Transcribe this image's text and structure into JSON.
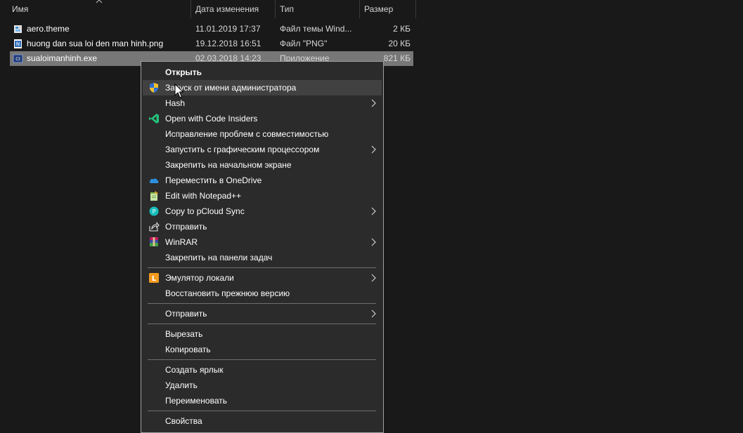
{
  "columns": {
    "name": "Имя",
    "date": "Дата изменения",
    "type": "Тип",
    "size": "Размер"
  },
  "files": [
    {
      "name": "aero.theme",
      "date": "11.01.2019 17:37",
      "type": "Файл темы Wind...",
      "size": "2 КБ",
      "icon": "theme-file-icon"
    },
    {
      "name": "huong dan sua loi den man hinh.png",
      "date": "19.12.2018 16:51",
      "type": "Файл \"PNG\"",
      "size": "20 КБ",
      "icon": "png-file-icon"
    },
    {
      "name": "sualoimanhinh.exe",
      "date": "02.03.2018 14:23",
      "type": "Приложение",
      "size": "821 КБ",
      "icon": "exe-file-icon",
      "selected": true
    }
  ],
  "menu": {
    "open": "Открыть",
    "run_as_admin": "Запуск от имени администратора",
    "hash": "Hash",
    "open_code_insiders": "Open with Code Insiders",
    "troubleshoot_compat": "Исправление проблем с совместимостью",
    "run_with_gpu": "Запустить с графическим процессором",
    "pin_to_start": "Закрепить на начальном экране",
    "move_to_onedrive": "Переместить в OneDrive",
    "edit_notepadpp": "Edit with Notepad++",
    "copy_pcloud": "Copy to pCloud Sync",
    "share": "Отправить",
    "winrar": "WinRAR",
    "pin_taskbar": "Закрепить на панели задач",
    "locale_emulator": "Эмулятор локали",
    "restore_version": "Восстановить прежнюю версию",
    "send_to": "Отправить",
    "cut": "Вырезать",
    "copy": "Копировать",
    "create_shortcut": "Создать ярлык",
    "delete": "Удалить",
    "rename": "Переименовать",
    "properties": "Свойства"
  },
  "colors": {
    "background": "#191919",
    "menu_background": "#2b2b2b",
    "selected_row": "#777777",
    "hover": "#414141",
    "vscode_insiders_green": "#24bf7a",
    "onedrive_blue": "#2d8fe0",
    "pcloud_teal": "#17bebb",
    "locale_orange": "#f29a1f"
  }
}
